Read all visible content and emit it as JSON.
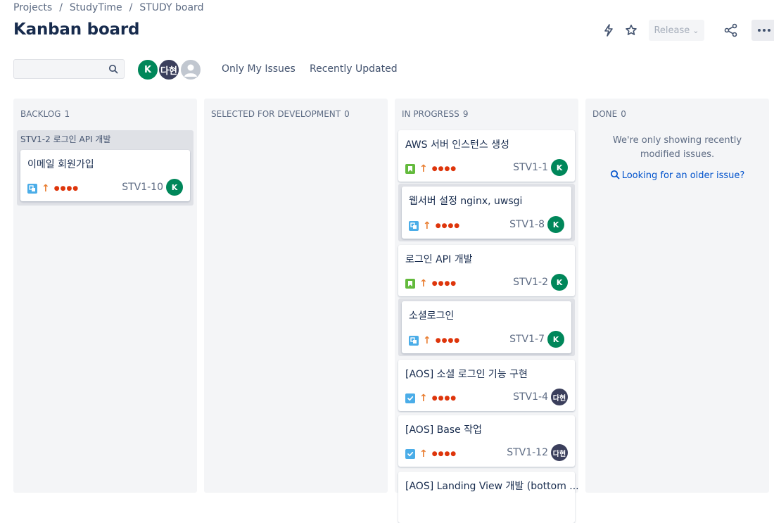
{
  "breadcrumbs": {
    "project_root": "Projects",
    "project": "StudyTime",
    "board": "STUDY board",
    "separator": "/"
  },
  "title": "Kanban board",
  "toolbar": {
    "release_label": "Release",
    "release_chevron": "⌄"
  },
  "search": {
    "placeholder": ""
  },
  "avatars": [
    {
      "initials": "K"
    },
    {
      "initials": "다현"
    }
  ],
  "filters": {
    "only_my_issues": "Only My Issues",
    "recently_updated": "Recently Updated"
  },
  "columns": {
    "backlog": {
      "name": "BACKLOG",
      "count": "1"
    },
    "selected": {
      "name": "SELECTED FOR DEVELOPMENT",
      "count": "0"
    },
    "in_progress": {
      "name": "IN PROGRESS",
      "count": "9"
    },
    "done": {
      "name": "DONE",
      "count": "0"
    }
  },
  "backlog_swimlane": {
    "label": "STV1-2 로그인 API 개발"
  },
  "backlog_cards": [
    {
      "title": "이메일 회원가입",
      "key": "STV1-10",
      "assignee": "K",
      "type": "subtask-icon"
    }
  ],
  "in_progress_cards": [
    {
      "title": "AWS 서버 인스턴스 생성",
      "key": "STV1-1",
      "assignee": "K",
      "type": "story-icon"
    },
    {
      "title": "웹서버 설정 nginx, uwsgi",
      "key": "STV1-8",
      "assignee": "K",
      "type": "subtask-icon"
    },
    {
      "title": "로그인 API 개발",
      "key": "STV1-2",
      "assignee": "K",
      "type": "story-icon"
    },
    {
      "title": "소셜로그인",
      "key": "STV1-7",
      "assignee": "K",
      "type": "subtask-icon"
    },
    {
      "title": "[AOS] 소셜 로그인 기능 구현",
      "key": "STV1-4",
      "assignee": "다현",
      "type": "task-icon"
    },
    {
      "title": "[AOS] Base 작업",
      "key": "STV1-12",
      "assignee": "다현",
      "type": "task-icon"
    },
    {
      "title": "[AOS] Landing View 개발 (bottom ...",
      "key": "",
      "assignee": "",
      "type": ""
    }
  ],
  "priority": {
    "arrow": "↑",
    "dots": "●●●●"
  },
  "done_column": {
    "message": "We're only showing recently modified issues.",
    "link": "Looking for an older issue?"
  },
  "colors": {
    "accent": "#0052cc",
    "avatar_k": "#00875a",
    "avatar_dahyun": "#3b3f5c",
    "story": "#63ba3c",
    "subtask": "#4bade8",
    "priority": "#e97f33",
    "dots": "#de350b"
  }
}
